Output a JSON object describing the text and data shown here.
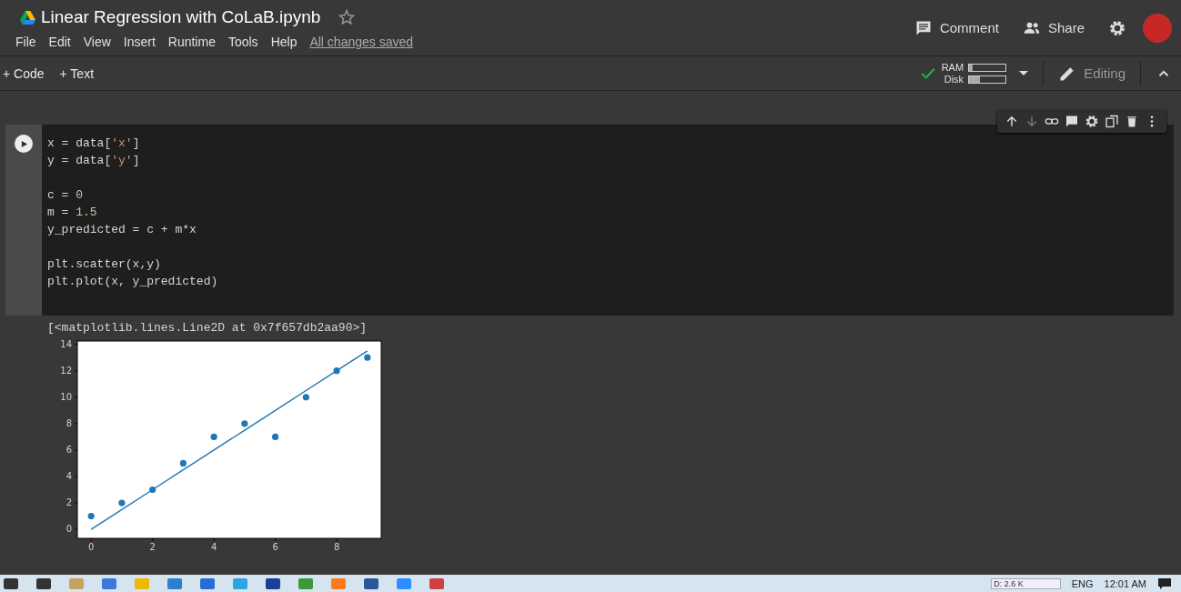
{
  "header": {
    "title": "Linear Regression with CoLaB.ipynb",
    "starred": false,
    "menu": [
      "File",
      "Edit",
      "View",
      "Insert",
      "Runtime",
      "Tools",
      "Help"
    ],
    "save_status": "All changes saved",
    "actions": [
      {
        "kind": "comment",
        "label": "Comment"
      },
      {
        "kind": "share",
        "label": "Share"
      }
    ]
  },
  "toolbar": {
    "add_buttons": [
      {
        "label": "+ Code"
      },
      {
        "label": "+ Text"
      }
    ],
    "connected": true,
    "meters": [
      {
        "label": "RAM",
        "level": 0.1
      },
      {
        "label": "Disk",
        "level": 0.3
      }
    ],
    "mode": "Editing"
  },
  "cell": {
    "code_blocks": [
      [
        [
          {
            "kind": "plain",
            "text": "x = data["
          },
          {
            "kind": "string",
            "text": "'x'"
          },
          {
            "kind": "plain",
            "text": "]"
          }
        ],
        [
          {
            "kind": "plain",
            "text": "y = data["
          },
          {
            "kind": "string",
            "text": "'y'"
          },
          {
            "kind": "plain",
            "text": "]"
          }
        ]
      ],
      [
        [
          {
            "kind": "plain",
            "text": "c = "
          },
          {
            "kind": "number",
            "text": "0"
          }
        ],
        [
          {
            "kind": "plain",
            "text": "m = "
          },
          {
            "kind": "number",
            "text": "1.5"
          }
        ],
        [
          {
            "kind": "plain",
            "text": "y_predicted = c + m*x"
          }
        ]
      ],
      [
        [
          {
            "kind": "plain",
            "text": "plt.scatter(x,y)"
          }
        ],
        [
          {
            "kind": "plain",
            "text": "plt.plot(x, y_predicted)"
          }
        ]
      ]
    ],
    "output_text": "[<matplotlib.lines.Line2D at 0x7f657db2aa90>]",
    "chart_data": {
      "type": "scatter",
      "x": [
        0,
        1,
        2,
        3,
        4,
        5,
        6,
        7,
        8,
        9
      ],
      "series": [
        {
          "color": "#1f77b4",
          "values": [
            1,
            2,
            3,
            5,
            7,
            8,
            7,
            10,
            12,
            13
          ]
        },
        {
          "type": "line",
          "color": "#1f77b4",
          "values": [
            0,
            1.5,
            3,
            4.5,
            6,
            7.5,
            9,
            10.5,
            12,
            13.5
          ]
        }
      ],
      "xlim": [
        -0.45,
        9.45
      ],
      "ylim": [
        -0.68,
        14.25
      ],
      "xticks": [
        0,
        2,
        4,
        6,
        8
      ],
      "yticks": [
        0,
        2,
        4,
        6,
        8,
        10,
        12,
        14
      ]
    }
  },
  "taskbar": {
    "meter_text": "D: 2.6 K",
    "language": "ENG",
    "time": "12:01 AM"
  }
}
